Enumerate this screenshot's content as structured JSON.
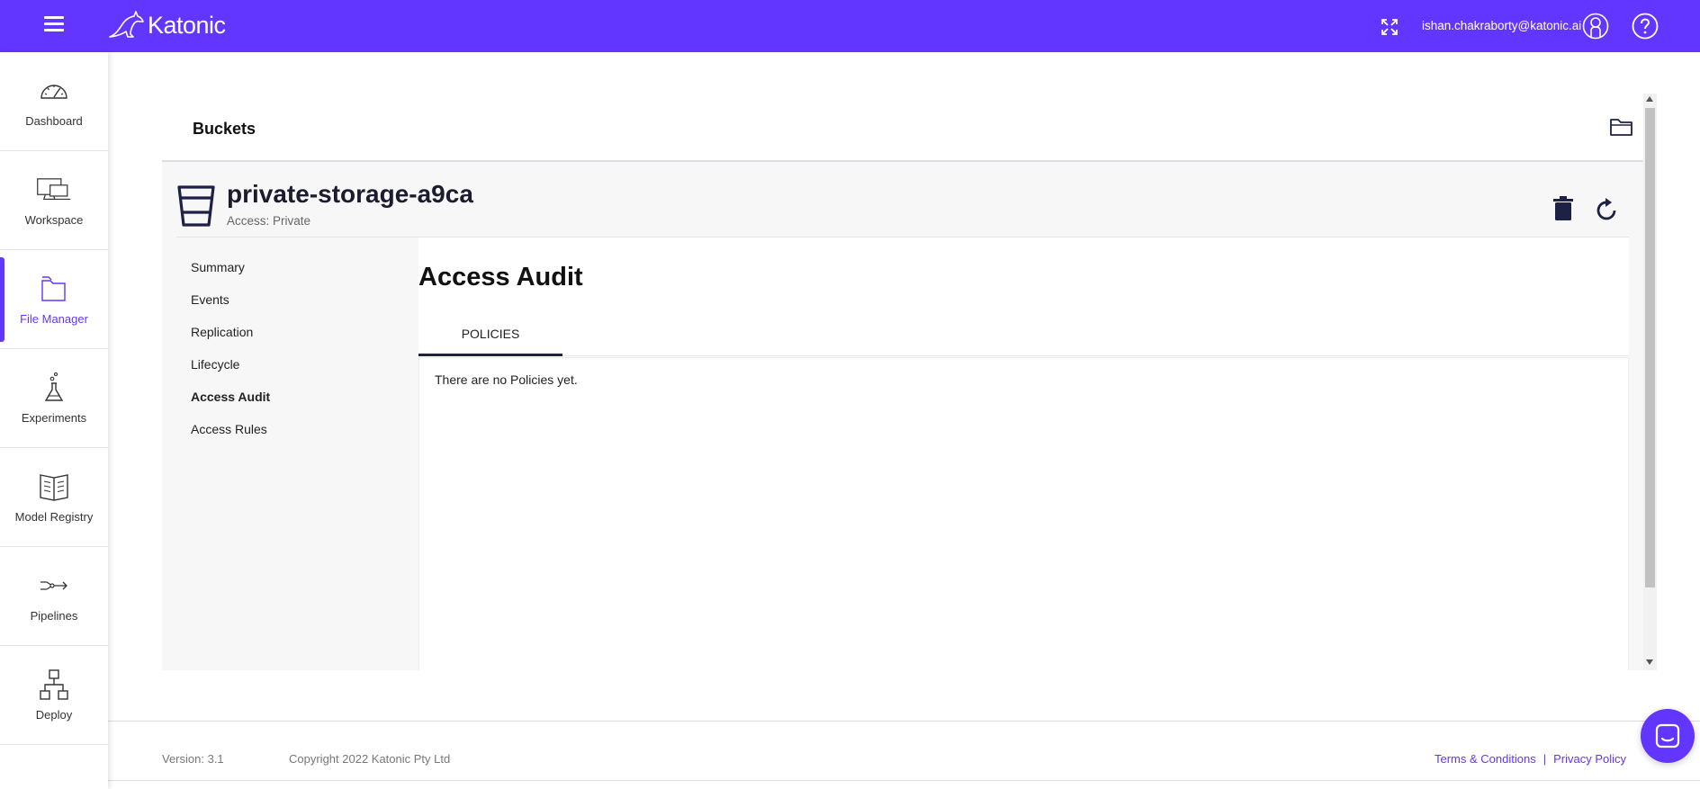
{
  "app": {
    "logo_text": "Katonic",
    "user_email": "ishan.chakraborty@katonic.ai"
  },
  "colors": {
    "brand": "#6236ff",
    "tab_underline": "#1c2145"
  },
  "icons": {
    "menu": "hamburger-menu-icon",
    "fullscreen": "expand-icon",
    "user": "user-avatar-icon",
    "help": "help-icon",
    "folder": "folder-icon",
    "bucket": "bucket-icon",
    "delete": "trash-icon",
    "refresh": "refresh-icon",
    "chat": "chat-icon"
  },
  "sidebar": {
    "items": [
      {
        "label": "Dashboard",
        "icon": "speedometer-icon",
        "active": false
      },
      {
        "label": "Workspace",
        "icon": "monitor-icon",
        "active": false
      },
      {
        "label": "File Manager",
        "icon": "folder-icon",
        "active": true
      },
      {
        "label": "Experiments",
        "icon": "flask-icon",
        "active": false
      },
      {
        "label": "Model Registry",
        "icon": "book-icon",
        "active": false
      },
      {
        "label": "Pipelines",
        "icon": "pipeline-icon",
        "active": false
      },
      {
        "label": "Deploy",
        "icon": "hierarchy-icon",
        "active": false
      }
    ]
  },
  "page": {
    "title": "Buckets"
  },
  "bucket": {
    "name": "private-storage-a9ca",
    "access": "Access: Private"
  },
  "submenu": {
    "items": [
      {
        "label": "Summary",
        "active": false
      },
      {
        "label": "Events",
        "active": false
      },
      {
        "label": "Replication",
        "active": false
      },
      {
        "label": "Lifecycle",
        "active": false
      },
      {
        "label": "Access Audit",
        "active": true
      },
      {
        "label": "Access Rules",
        "active": false
      }
    ]
  },
  "content": {
    "title": "Access Audit",
    "tabs": [
      {
        "label": "POLICIES",
        "active": true
      }
    ],
    "empty_message": "There are no Policies yet."
  },
  "footer": {
    "version": "Version: 3.1",
    "copyright": "Copyright 2022 Katonic Pty Ltd",
    "terms": "Terms & Conditions",
    "separator": "|",
    "privacy": "Privacy Policy"
  }
}
